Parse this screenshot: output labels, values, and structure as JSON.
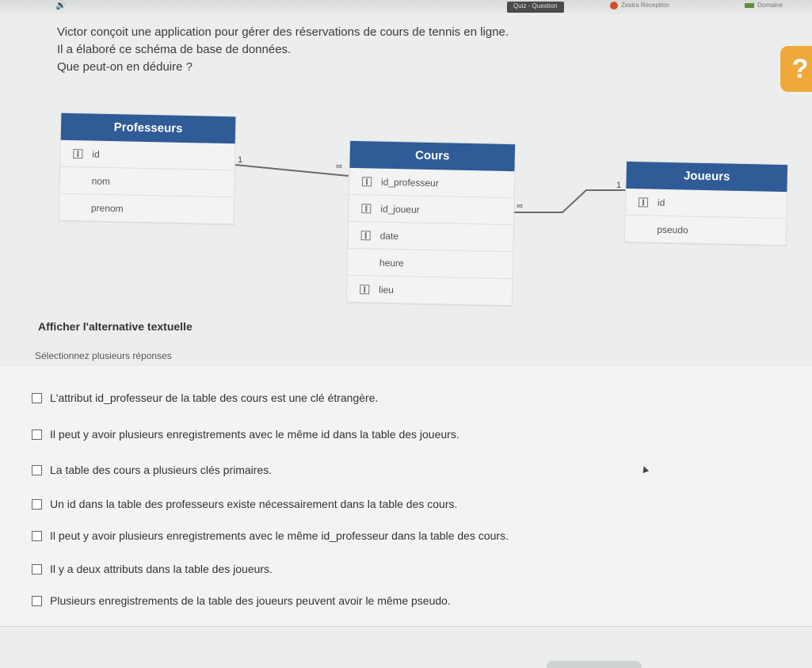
{
  "topbar": {
    "tab1": "Quiz - Question",
    "tab2": "Zestra Reception",
    "tab3": "Domaine"
  },
  "question": {
    "line1": "Victor conçoit une application pour gérer des réservations de cours de tennis en ligne.",
    "line2": "Il a élaboré ce schéma de base de données.",
    "line3": "Que peut-on en déduire ?"
  },
  "help": {
    "label": "?"
  },
  "schema": {
    "professeurs": {
      "title": "Professeurs",
      "fields": [
        "id",
        "nom",
        "prenom"
      ]
    },
    "cours": {
      "title": "Cours",
      "fields": [
        "id_professeur",
        "id_joueur",
        "date",
        "heure",
        "lieu"
      ]
    },
    "joueurs": {
      "title": "Joueurs",
      "fields": [
        "id",
        "pseudo"
      ]
    },
    "links": {
      "prof_cours_left": "1",
      "prof_cours_right": "∞",
      "cours_joueurs_left": "∞",
      "cours_joueurs_right": "1"
    }
  },
  "alt_text_link": "Afficher l'alternative textuelle",
  "instruction": "Sélectionnez plusieurs réponses",
  "choices": [
    "L'attribut id_professeur de la table des cours est une clé étrangère.",
    "Il peut y avoir plusieurs enregistrements avec le même id dans la table des joueurs.",
    "La table des cours a plusieurs clés primaires.",
    "Un id dans la table des professeurs existe nécessairement dans la table des cours.",
    "Il peut y avoir plusieurs enregistrements avec le même id_professeur dans la table des cours.",
    "Il y a deux attributs dans la table des joueurs.",
    "Plusieurs enregistrements de la table des joueurs peuvent avoir le même pseudo."
  ]
}
